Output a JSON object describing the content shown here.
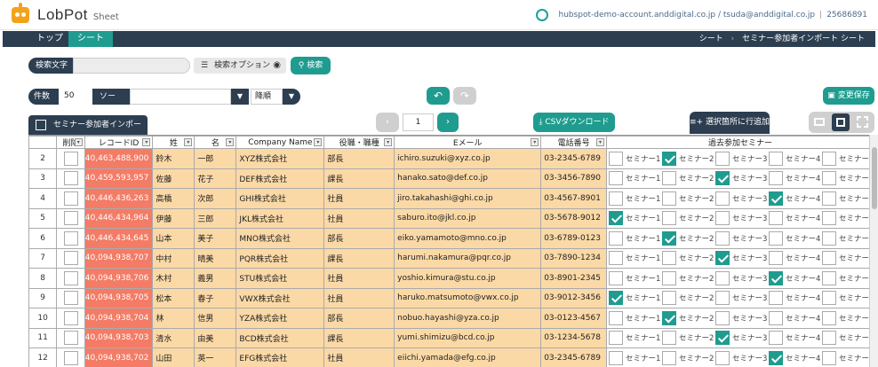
{
  "header": {
    "logo": "LobPot",
    "sub": "Sheet",
    "account": "hubspot-demo-account.anddigital.co.jp / tsuda@anddigital.co.jp",
    "account_id": "25686891"
  },
  "nav": {
    "tab_top": "トップ",
    "tab_sheet": "シート",
    "crumb_1": "シート",
    "crumb_sep": "›",
    "crumb_2": "セミナー参加者インポート シート"
  },
  "search": {
    "label": "検索文字",
    "value": "",
    "options_label": "検索オプション",
    "search_button": "検索"
  },
  "toolbar": {
    "count_label": "件数",
    "count_value": "50",
    "sort_label": "ソート",
    "sort_value": "",
    "order_value": "降順",
    "save_label": "変更保存",
    "page_value": "1",
    "csv_label": "CSVダウンロード",
    "add_row_label": "選択箇所に行追加"
  },
  "grid": {
    "title": "セミナー参加者インポート",
    "columns": [
      "削除",
      "レコードID",
      "姓",
      "名",
      "Company Name",
      "役職・職種",
      "Eメール",
      "電話番号",
      "過去参加セミナー"
    ],
    "seminar_labels": [
      "セミナー1",
      "セミナー2",
      "セミナー3",
      "セミナー4",
      "セミナー"
    ],
    "rows": [
      {
        "n": "2",
        "id": "40,463,488,900",
        "last": "鈴木",
        "first": "一郎",
        "company": "XYZ株式会社",
        "role": "部長",
        "email": "ichiro.suzuki@xyz.co.jp",
        "phone": "03-2345-6789",
        "checked": [
          1
        ]
      },
      {
        "n": "3",
        "id": "40,459,593,957",
        "last": "佐藤",
        "first": "花子",
        "company": "DEF株式会社",
        "role": "課長",
        "email": "hanako.sato@def.co.jp",
        "phone": "03-3456-7890",
        "checked": [
          2
        ]
      },
      {
        "n": "4",
        "id": "40,446,436,263",
        "last": "高橋",
        "first": "次郎",
        "company": "GHI株式会社",
        "role": "社員",
        "email": "jiro.takahashi@ghi.co.jp",
        "phone": "03-4567-8901",
        "checked": [
          3
        ]
      },
      {
        "n": "5",
        "id": "40,446,434,964",
        "last": "伊藤",
        "first": "三郎",
        "company": "JKL株式会社",
        "role": "社員",
        "email": "saburo.ito@jkl.co.jp",
        "phone": "03-5678-9012",
        "checked": [
          0
        ]
      },
      {
        "n": "6",
        "id": "40,446,434,645",
        "last": "山本",
        "first": "美子",
        "company": "MNO株式会社",
        "role": "部長",
        "email": "eiko.yamamoto@mno.co.jp",
        "phone": "03-6789-0123",
        "checked": [
          1
        ]
      },
      {
        "n": "7",
        "id": "40,094,938,707",
        "last": "中村",
        "first": "晴美",
        "company": "PQR株式会社",
        "role": "課長",
        "email": "harumi.nakamura@pqr.co.jp",
        "phone": "03-7890-1234",
        "checked": [
          2
        ]
      },
      {
        "n": "8",
        "id": "40,094,938,706",
        "last": "木村",
        "first": "義男",
        "company": "STU株式会社",
        "role": "社員",
        "email": "yoshio.kimura@stu.co.jp",
        "phone": "03-8901-2345",
        "checked": [
          3
        ]
      },
      {
        "n": "9",
        "id": "40,094,938,705",
        "last": "松本",
        "first": "春子",
        "company": "VWX株式会社",
        "role": "社員",
        "email": "haruko.matsumoto@vwx.co.jp",
        "phone": "03-9012-3456",
        "checked": [
          0
        ]
      },
      {
        "n": "10",
        "id": "40,094,938,704",
        "last": "林",
        "first": "信男",
        "company": "YZA株式会社",
        "role": "部長",
        "email": "nobuo.hayashi@yza.co.jp",
        "phone": "03-0123-4567",
        "checked": [
          1
        ]
      },
      {
        "n": "11",
        "id": "40,094,938,703",
        "last": "清水",
        "first": "由美",
        "company": "BCD株式会社",
        "role": "課長",
        "email": "yumi.shimizu@bcd.co.jp",
        "phone": "03-1234-5678",
        "checked": [
          2
        ]
      },
      {
        "n": "12",
        "id": "40,094,938,702",
        "last": "山田",
        "first": "英一",
        "company": "EFG株式会社",
        "role": "社員",
        "email": "eiichi.yamada@efg.co.jp",
        "phone": "03-2345-6789",
        "checked": [
          3
        ]
      }
    ]
  },
  "colors": {
    "navy": "#2c3e50",
    "teal": "#1f9c8f",
    "record_id_bg": "#f47c66",
    "cell_bg": "#fbd9a6",
    "logo_orange": "#f3a21b"
  },
  "icons": {
    "theme": "sun-icon",
    "options": "filter-list-icon",
    "visibility": "eye-off-icon",
    "search": "magnifier-icon",
    "undo": "undo-icon",
    "redo": "redo-icon",
    "save": "floppy-icon",
    "csv": "download-icon",
    "add_row": "add-row-icon",
    "grid": "table-icon"
  }
}
